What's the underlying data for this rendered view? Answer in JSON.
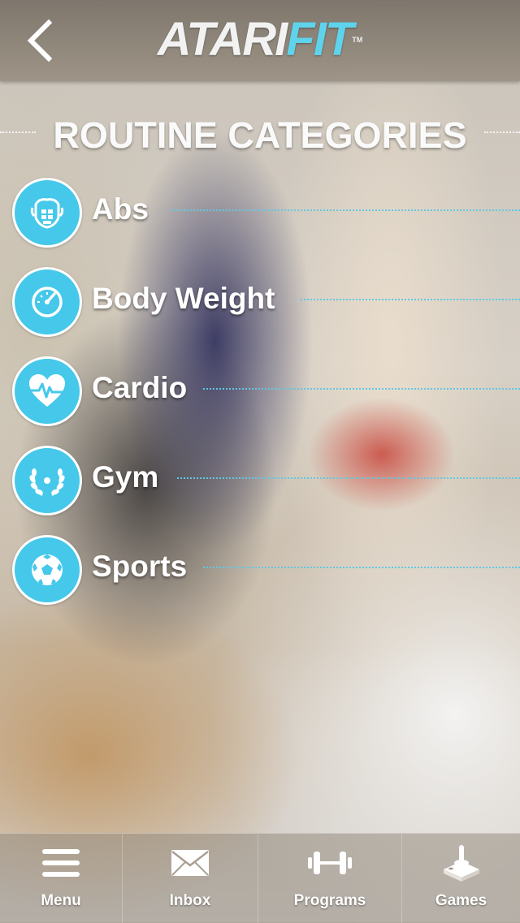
{
  "header": {
    "logo_part1": "ATARI",
    "logo_part2": "FIT",
    "logo_tm": "TM"
  },
  "title": "ROUTINE CATEGORIES",
  "categories": [
    {
      "label": "Abs",
      "icon": "abs-icon"
    },
    {
      "label": "Body Weight",
      "icon": "gauge-icon"
    },
    {
      "label": "Cardio",
      "icon": "heart-pulse-icon"
    },
    {
      "label": "Gym",
      "icon": "laurel-icon"
    },
    {
      "label": "Sports",
      "icon": "soccer-ball-icon"
    }
  ],
  "tabbar": {
    "items": [
      {
        "label": "Menu",
        "icon": "hamburger-menu-icon"
      },
      {
        "label": "Inbox",
        "icon": "envelope-icon"
      },
      {
        "label": "Programs",
        "icon": "dumbbell-icon"
      },
      {
        "label": "Games",
        "icon": "joystick-icon"
      }
    ]
  },
  "colors": {
    "accent": "#45c8ea",
    "logo_accent": "#5fd3ec"
  }
}
